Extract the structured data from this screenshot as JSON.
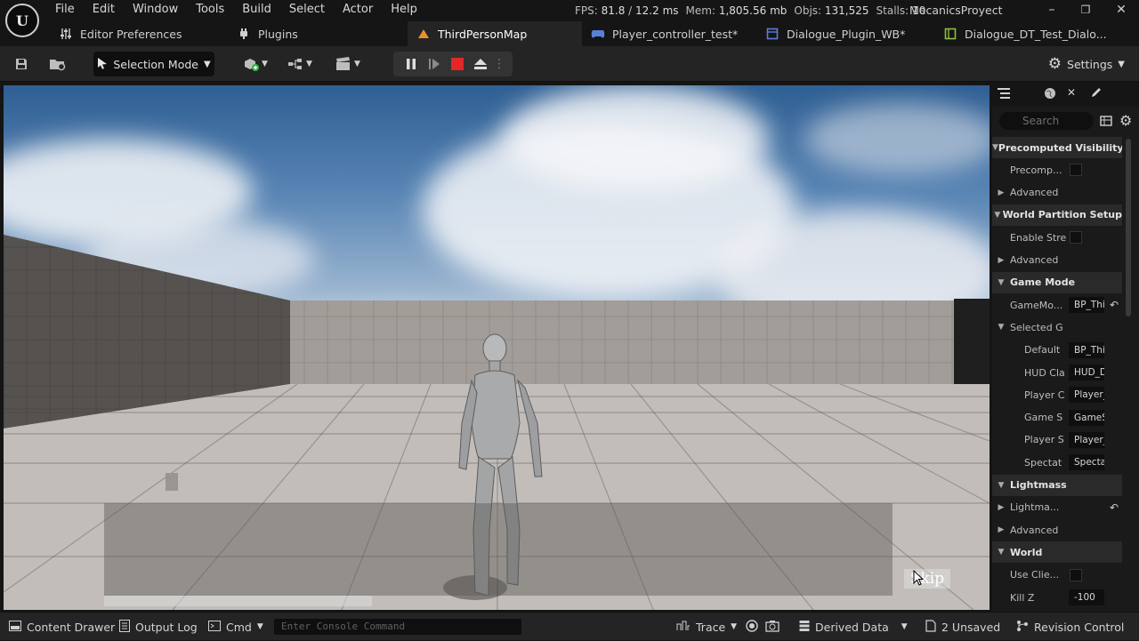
{
  "menu": [
    "File",
    "Edit",
    "Window",
    "Tools",
    "Build",
    "Select",
    "Actor",
    "Help"
  ],
  "stats": {
    "fps_label": "FPS:",
    "fps_value": "81.8",
    "ms_value": "12.2 ms",
    "mem_label": "Mem:",
    "mem_value": "1,805.56 mb",
    "objs_label": "Objs:",
    "objs_value": "131,525",
    "stalls_label": "Stalls:",
    "stalls_value": "10"
  },
  "project_name": "MecanicsProyect",
  "window_controls": {
    "minimize": "–",
    "restore": "❐",
    "close": "✕"
  },
  "tabs": [
    {
      "label": "Editor Preferences",
      "icon": "sliders-icon"
    },
    {
      "label": "Plugins",
      "icon": "plug-icon"
    },
    {
      "label": "ThirdPersonMap",
      "icon": "level-icon"
    },
    {
      "label": "Player_controller_test*",
      "icon": "gamepad-icon"
    },
    {
      "label": "Dialogue_Plugin_WB*",
      "icon": "widget-icon"
    },
    {
      "label": "Dialogue_DT_Test_Dialo...",
      "icon": "datatable-icon"
    }
  ],
  "toolbar": {
    "selection_mode": "Selection Mode",
    "settings": "Settings"
  },
  "viewport": {
    "skip_label": "Skip",
    "dialogue_progress": 0.34
  },
  "panel": {
    "search_placeholder": "Search",
    "rows": [
      {
        "type": "cat",
        "label": "Precomputed Visibility"
      },
      {
        "type": "prop",
        "label": "Precomp...",
        "control": "checkbox"
      },
      {
        "type": "sub",
        "label": "Advanced"
      },
      {
        "type": "cat",
        "label": "World Partition Setup"
      },
      {
        "type": "prop",
        "label": "Enable Stre",
        "control": "checkbox"
      },
      {
        "type": "sub",
        "label": "Advanced"
      },
      {
        "type": "cat",
        "label": "Game Mode"
      },
      {
        "type": "prop",
        "label": "GameMo...",
        "value": "BP_Thi",
        "reset": true
      },
      {
        "type": "subcat",
        "label": "Selected G"
      },
      {
        "type": "prop2",
        "label": "Default",
        "value": "BP_Thi"
      },
      {
        "type": "prop2",
        "label": "HUD Cla",
        "value": "HUD_D"
      },
      {
        "type": "prop2",
        "label": "Player C",
        "value": "Player_"
      },
      {
        "type": "prop2",
        "label": "Game S",
        "value": "GameS"
      },
      {
        "type": "prop2",
        "label": "Player S",
        "value": "Player_"
      },
      {
        "type": "prop2",
        "label": "Spectat",
        "value": "Specta"
      },
      {
        "type": "cat",
        "label": "Lightmass"
      },
      {
        "type": "sub",
        "label": "Lightma...",
        "reset": true
      },
      {
        "type": "sub",
        "label": "Advanced"
      },
      {
        "type": "cat",
        "label": "World"
      },
      {
        "type": "prop",
        "label": "Use Clie...",
        "control": "checkbox"
      },
      {
        "type": "prop",
        "label": "Kill Z",
        "value": "-100"
      }
    ]
  },
  "statusbar": {
    "content_drawer": "Content Drawer",
    "output_log": "Output Log",
    "cmd": "Cmd",
    "console_placeholder": "Enter Console Command",
    "trace": "Trace",
    "derived_data": "Derived Data",
    "unsaved": "2 Unsaved",
    "revision_control": "Revision Control"
  }
}
